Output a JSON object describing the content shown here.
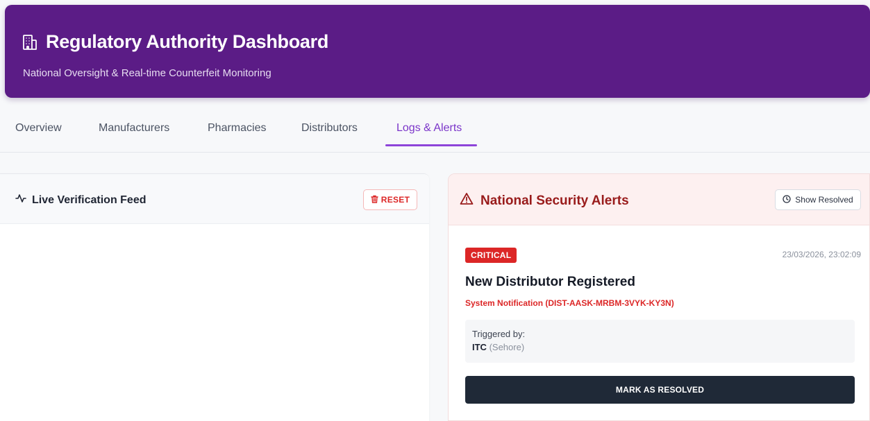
{
  "header": {
    "title": "Regulatory Authority Dashboard",
    "subtitle": "National Oversight & Real-time Counterfeit Monitoring",
    "icon": "building-icon"
  },
  "tabs": [
    {
      "label": "Overview",
      "active": false
    },
    {
      "label": "Manufacturers",
      "active": false
    },
    {
      "label": "Pharmacies",
      "active": false
    },
    {
      "label": "Distributors",
      "active": false
    },
    {
      "label": "Logs & Alerts",
      "active": true
    }
  ],
  "feed": {
    "title": "Live Verification Feed",
    "icon": "activity-icon",
    "reset_label": "RESET",
    "reset_icon": "trash-icon"
  },
  "alerts": {
    "title": "National Security Alerts",
    "icon": "warning-triangle-icon",
    "show_resolved_label": "Show Resolved",
    "show_resolved_icon": "clock-icon",
    "items": [
      {
        "severity": "CRITICAL",
        "timestamp": "23/03/2026, 23:02:09",
        "title": "New Distributor Registered",
        "subtitle": "System Notification (DIST-AASK-MRBM-3VYK-KY3N)",
        "triggered_label": "Triggered by:",
        "triggered_name": "ITC",
        "triggered_location": "(Sehore)",
        "action_label": "MARK AS RESOLVED"
      }
    ]
  },
  "colors": {
    "header_bg": "#5b1c86",
    "accent": "#7b35c9",
    "critical": "#dc2626",
    "alert_title": "#991b1b",
    "button_dark": "#1f2937"
  }
}
